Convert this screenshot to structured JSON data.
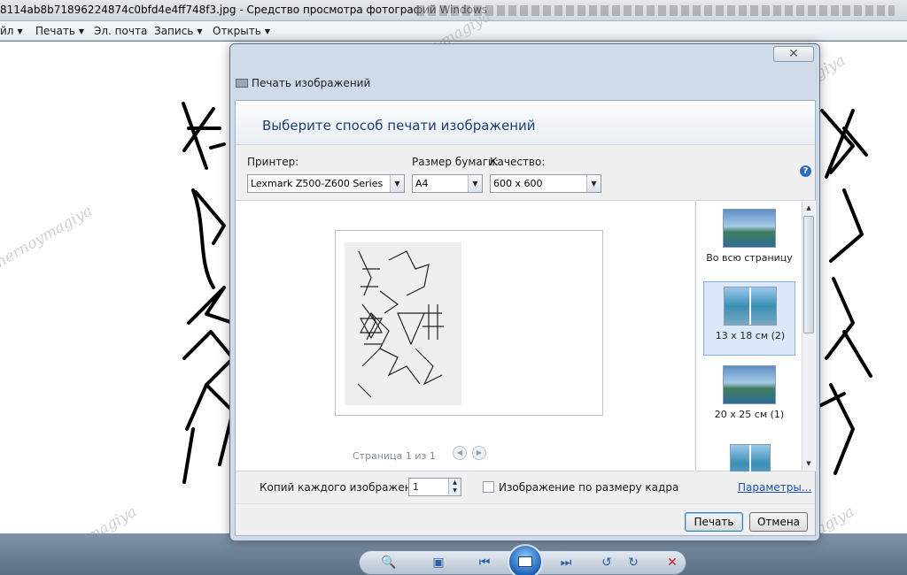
{
  "window": {
    "title": "8114ab8b71896224874c0bfd4e4ff748f3.jpg - Средство просмотра фотографий Windows"
  },
  "menu": {
    "items": [
      {
        "label": "йл"
      },
      {
        "label": "Печать"
      },
      {
        "label": "Эл. почта"
      },
      {
        "label": "Запись"
      },
      {
        "label": "Открыть"
      }
    ]
  },
  "dialog": {
    "title": "Печать изображений",
    "close_label": "✕",
    "heading": "Выберите способ печати изображений",
    "printer": {
      "label": "Принтер:",
      "value": "Lexmark Z500-Z600 Series"
    },
    "paper": {
      "label": "Размер бумаги:",
      "value": "A4"
    },
    "quality": {
      "label": "Качество:",
      "value": "600 x 600"
    },
    "help_label": "?",
    "page_nav": "Страница 1 из 1",
    "layouts": [
      {
        "label": "Во всю страницу",
        "selected": false
      },
      {
        "label": "13 x 18 см (2)",
        "selected": true
      },
      {
        "label": "20 x 25 см (1)",
        "selected": false
      },
      {
        "label": "",
        "selected": false
      }
    ],
    "copies": {
      "label": "Копий каждого изображения:",
      "value": "1"
    },
    "fit_frame": {
      "label": "Изображение по размеру кадра",
      "checked": false
    },
    "options_link": "Параметры...",
    "print_button": "Печать",
    "cancel_button": "Отмена"
  },
  "watermark": "chernoymagiya",
  "colors": {
    "dialog_frame": "#cfdbe8",
    "heading": "#1e3f78",
    "link": "#1a55b0",
    "selection": "#dbe8f7"
  }
}
